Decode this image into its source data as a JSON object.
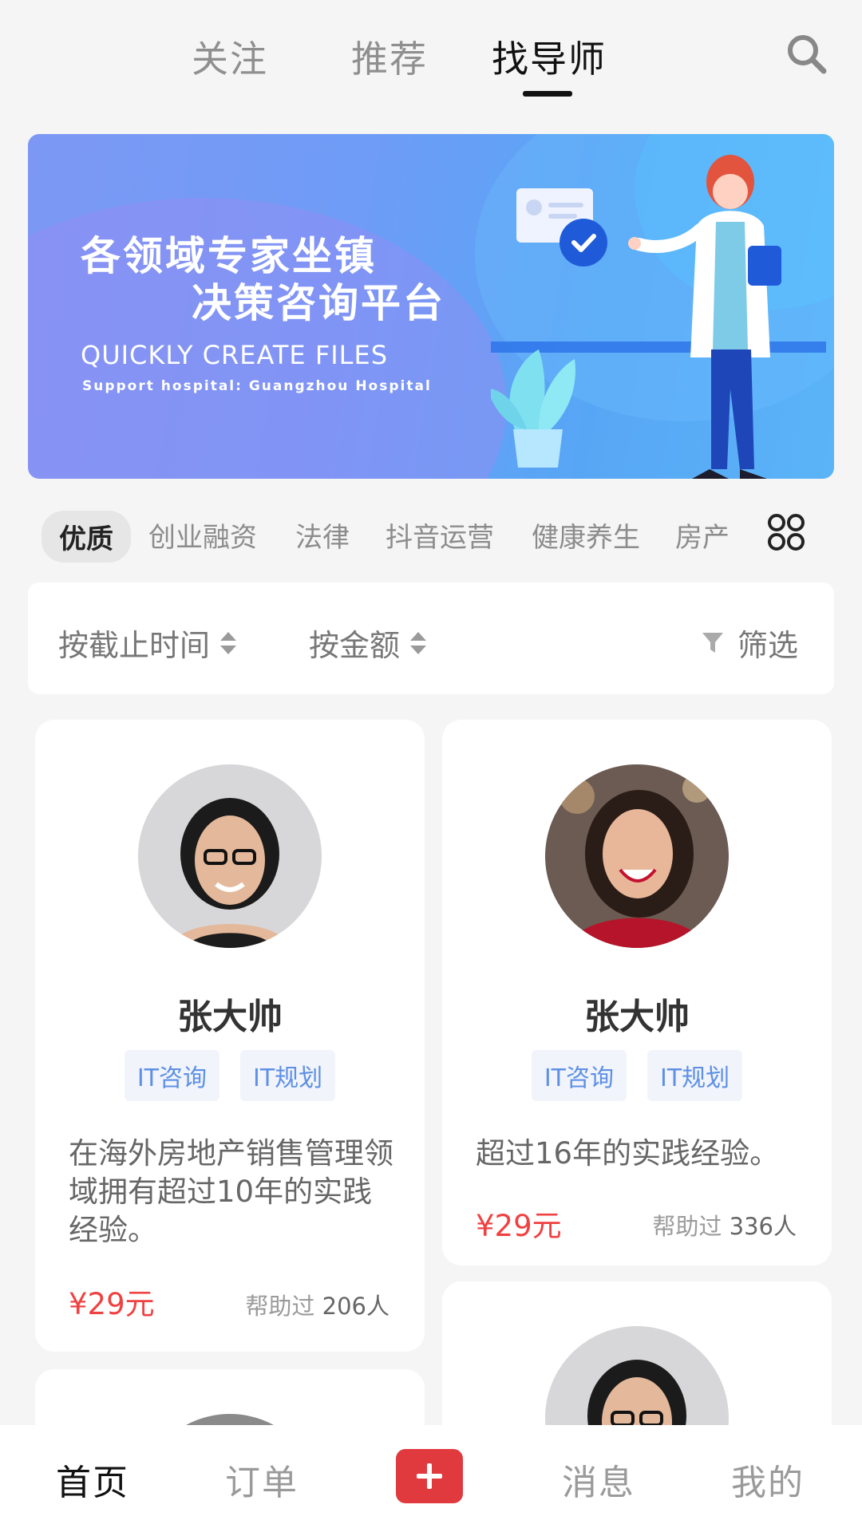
{
  "topnav": {
    "tabs": [
      {
        "label": "关注"
      },
      {
        "label": "推荐"
      },
      {
        "label": "找导师"
      }
    ],
    "active_index": 2
  },
  "banner": {
    "title_line1": "各领域专家坐镇",
    "title_line2": "决策咨询平台",
    "subtitle": "QUICKLY CREATE FILES",
    "support_text": "Support hospital: Guangzhou Hospital"
  },
  "categories": {
    "items": [
      "优质",
      "创业融资",
      "法律",
      "抖音运营",
      "健康养生",
      "房产"
    ],
    "active_index": 0
  },
  "filters": {
    "sort_deadline": "按截止时间",
    "sort_amount": "按金额",
    "filter_label": "筛选"
  },
  "cards": [
    {
      "name": "张大帅",
      "tags": [
        "IT咨询",
        "IT规划"
      ],
      "desc": "在海外房地产销售管理领域拥有超过10年的实践经验。",
      "price": "¥29元",
      "helped_prefix": "帮助过",
      "helped_count": "206人"
    },
    {
      "name": "张大帅",
      "tags": [
        "IT咨询",
        "IT规划"
      ],
      "desc": "超过16年的实践经验。",
      "price": "¥29元",
      "helped_prefix": "帮助过",
      "helped_count": "336人"
    }
  ],
  "bottomnav": {
    "items": [
      "首页",
      "订单",
      "消息",
      "我的"
    ],
    "active_index": 0
  },
  "colors": {
    "accent_red": "#e0393e",
    "price_red": "#f04141",
    "tag_blue": "#5e90e6"
  }
}
